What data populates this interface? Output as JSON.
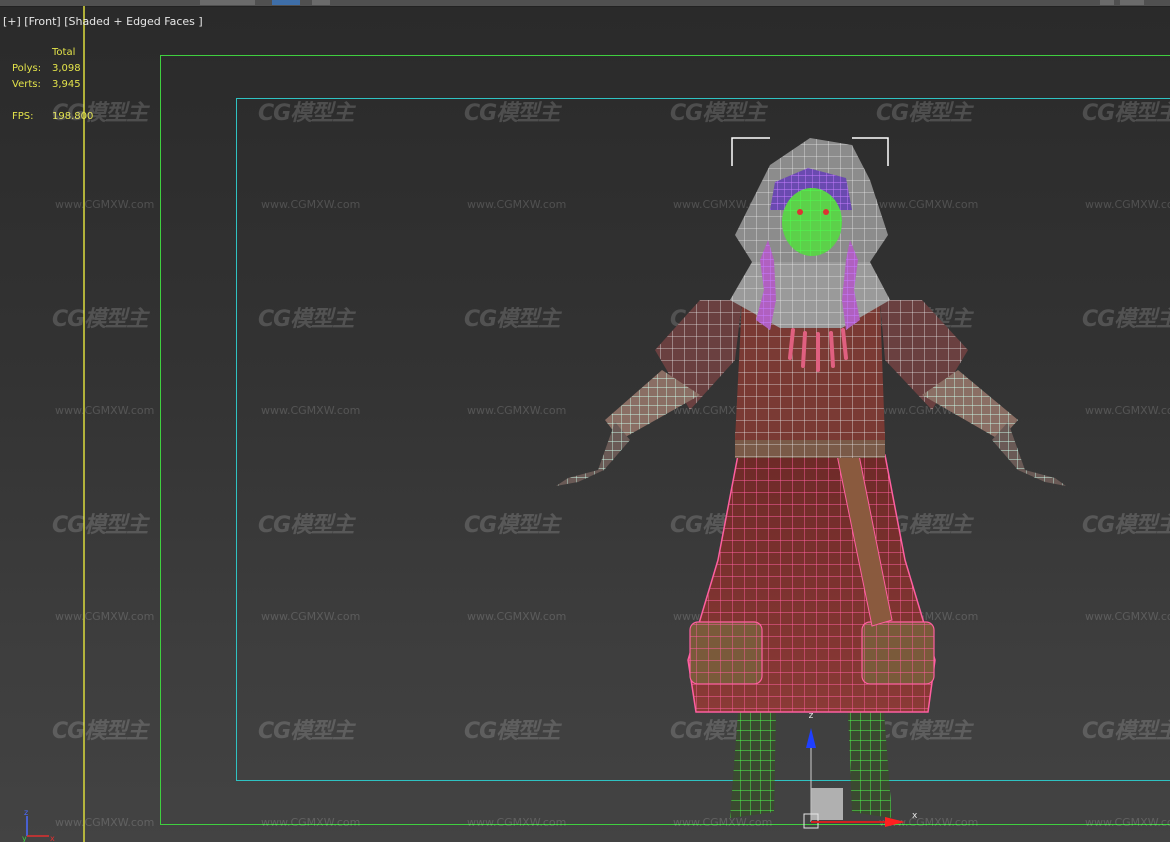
{
  "viewport": {
    "label": "[+] [Front] [Shaded + Edged Faces ]",
    "stats": {
      "total_label": "Total",
      "polys_label": "Polys:",
      "polys_value": "3,098",
      "verts_label": "Verts:",
      "verts_value": "3,945",
      "fps_label": "FPS:",
      "fps_value": "198.800"
    },
    "gizmo": {
      "z_label": "z",
      "x_label": "x"
    },
    "tripod": {
      "z_label": "z",
      "y_label": "y",
      "x_label": "x"
    }
  },
  "watermark": {
    "logo_text": "CG模型主",
    "url_text": "www.CGMXW.com"
  },
  "colors": {
    "safe_frame_outer": "#3fcf3f",
    "safe_frame_inner": "#2fc2c2",
    "stats_text": "#e3e34a",
    "robe": "#7a2f2c",
    "selection_wire": "#ff5fa0",
    "skin_wire": "#c9f7e6"
  }
}
